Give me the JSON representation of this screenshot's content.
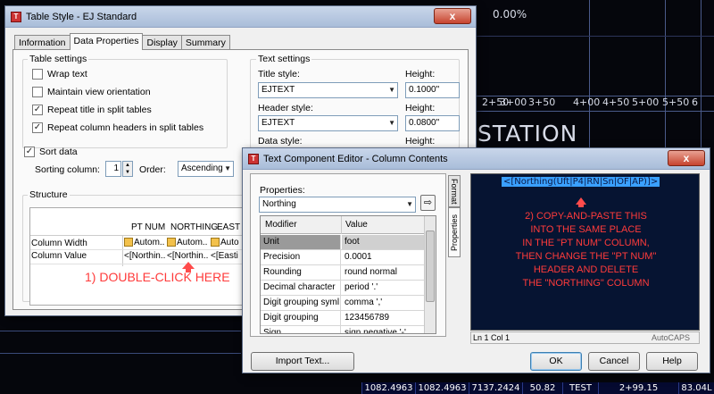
{
  "cad": {
    "percent": "0.00%",
    "station_label": "STATION",
    "ticks": [
      "2+50",
      "3+00",
      "3+50",
      "4+00",
      "4+50",
      "5+00",
      "5+50",
      "6"
    ],
    "status": [
      "1082.4963",
      "1082.4963",
      "7137.2424",
      "50.82",
      "TEST",
      "2+99.15",
      "83.04L"
    ]
  },
  "table_style": {
    "title": "Table Style - EJ Standard",
    "close": "x",
    "tabs": [
      "Information",
      "Data Properties",
      "Display",
      "Summary"
    ],
    "table_settings": {
      "label": "Table settings",
      "wrap_text": "Wrap text",
      "maintain_view": "Maintain view orientation",
      "repeat_title": "Repeat title in split tables",
      "repeat_headers": "Repeat column headers in split tables",
      "repeat_title_checked": true,
      "repeat_headers_checked": true
    },
    "text_settings": {
      "label": "Text settings",
      "title_style_label": "Title style:",
      "title_style_value": "EJTEXT",
      "title_height_label": "Height:",
      "title_height_value": "0.1000\"",
      "header_style_label": "Header style:",
      "header_style_value": "EJTEXT",
      "header_height_label": "Height:",
      "header_height_value": "0.0800\"",
      "data_style_label": "Data style:",
      "data_height_label": "Height:"
    },
    "sort": {
      "label": "Sort data",
      "checked": true,
      "column_label": "Sorting column:",
      "column_value": "1",
      "order_label": "Order:",
      "order_value": "Ascending"
    },
    "structure": {
      "label": "Structure",
      "headers": [
        "PT NUM",
        "NORTHING",
        "EAST"
      ],
      "row1_label": "Column Width",
      "row1_cells": [
        "Autom...",
        "Autom...",
        "Auto"
      ],
      "row2_label": "Column Value",
      "row2_cells": [
        "<[Northin...",
        "<[Northin...",
        "<[Easti"
      ]
    },
    "annotation": "1) DOUBLE-CLICK HERE"
  },
  "tce": {
    "title": "Text Component Editor - Column Contents",
    "close": "x",
    "properties_label": "Properties:",
    "properties_value": "Northing",
    "side_tabs": [
      "Properties",
      "Format"
    ],
    "grid_headers": [
      "Modifier",
      "Value"
    ],
    "grid_rows": [
      {
        "k": "Unit",
        "v": "foot"
      },
      {
        "k": "Precision",
        "v": "0.0001"
      },
      {
        "k": "Rounding",
        "v": "round normal"
      },
      {
        "k": "Decimal character",
        "v": "period '.'"
      },
      {
        "k": "Digit grouping syml",
        "v": "comma ','"
      },
      {
        "k": "Digit grouping",
        "v": "123456789"
      },
      {
        "k": "Sign",
        "v": "sign negative '-'"
      }
    ],
    "editor_text": "<[Northing(Uft|P4|RN|Sn|OF|AP)]>",
    "instruction_lines": [
      "2) COPY-AND-PASTE THIS",
      "INTO THE SAME PLACE",
      "IN THE \"PT NUM\" COLUMN,",
      "THEN CHANGE THE \"PT NUM\"",
      "HEADER AND DELETE",
      "THE \"NORTHING\" COLUMN"
    ],
    "status_left": "Ln 1 Col 1",
    "status_right": "AutoCAPS",
    "import_button": "Import Text...",
    "ok_button": "OK",
    "cancel_button": "Cancel",
    "help_button": "Help"
  }
}
